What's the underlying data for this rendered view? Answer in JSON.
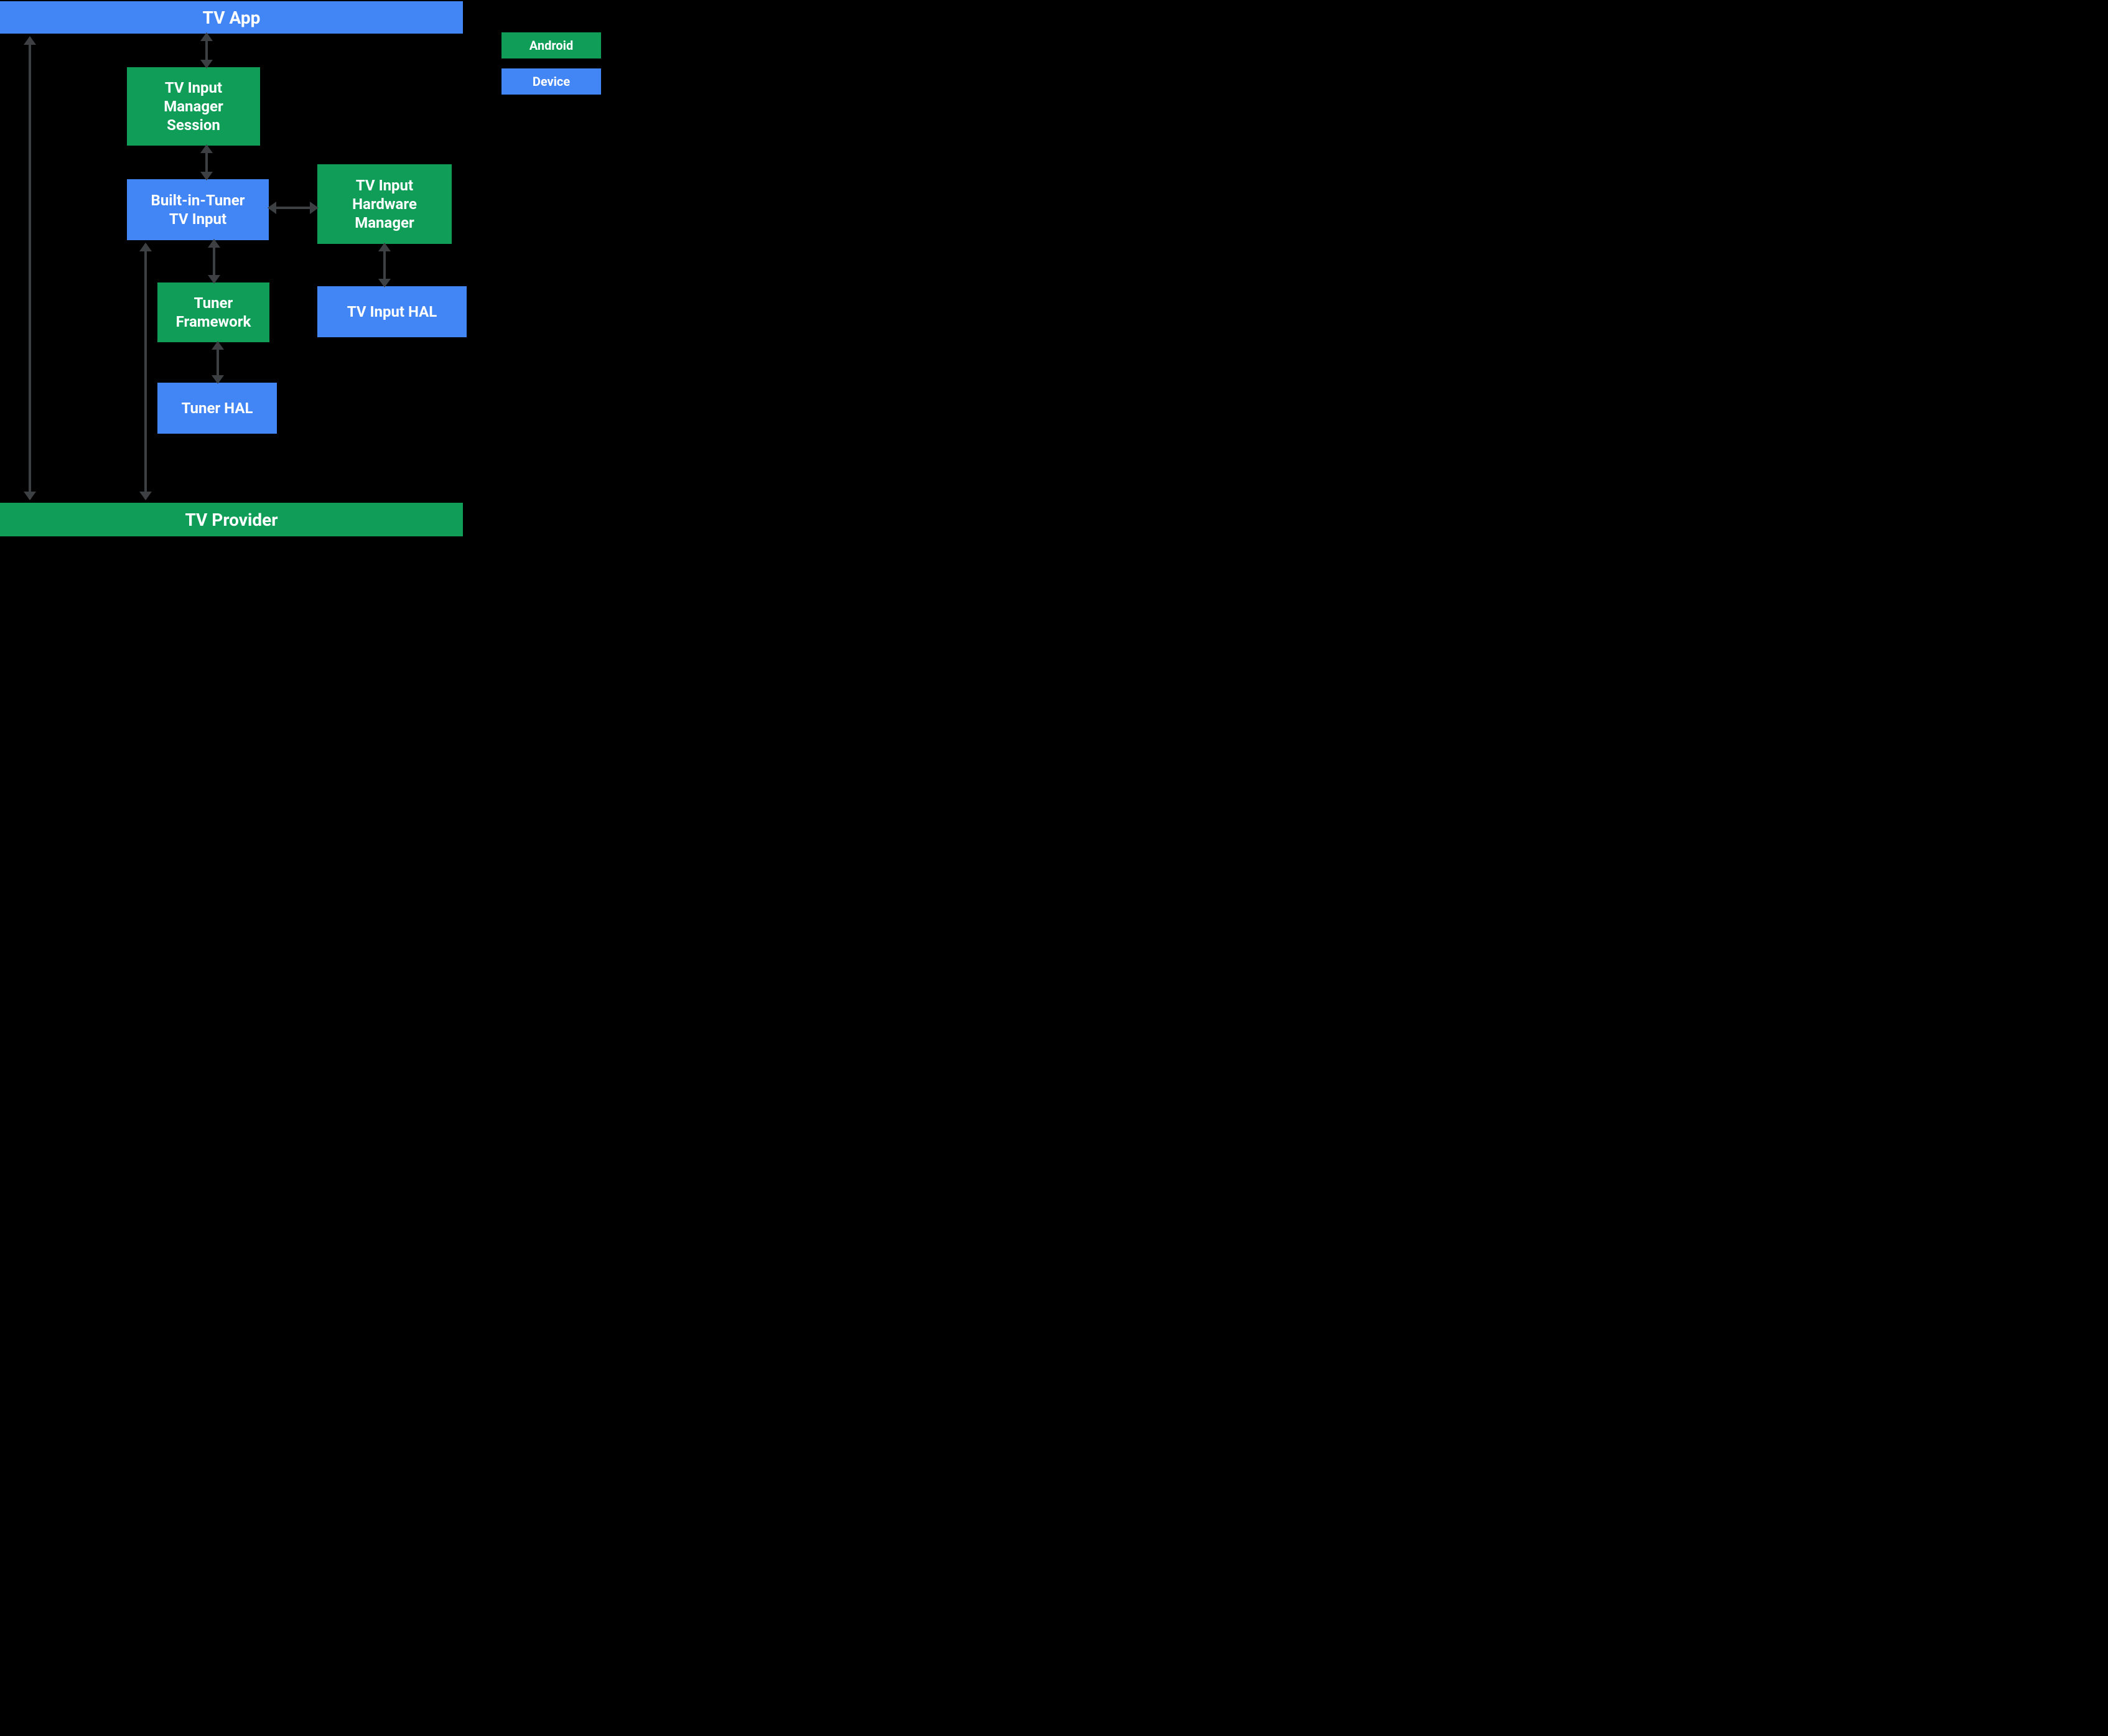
{
  "colors": {
    "blue": "#4285f4",
    "green": "#0f9d58",
    "arrow": "#3c4043"
  },
  "legend": {
    "android": "Android",
    "device": "Device"
  },
  "nodes": {
    "tv_app": "TV App",
    "tims": "TV Input\nManager\nSession",
    "builtin_tuner": "Built-in-Tuner\nTV Input",
    "hw_mgr": "TV Input\nHardware\nManager",
    "tuner_fw": "Tuner\nFramework",
    "tv_input_hal": "TV Input HAL",
    "tuner_hal": "Tuner HAL",
    "tv_provider": "TV Provider"
  }
}
